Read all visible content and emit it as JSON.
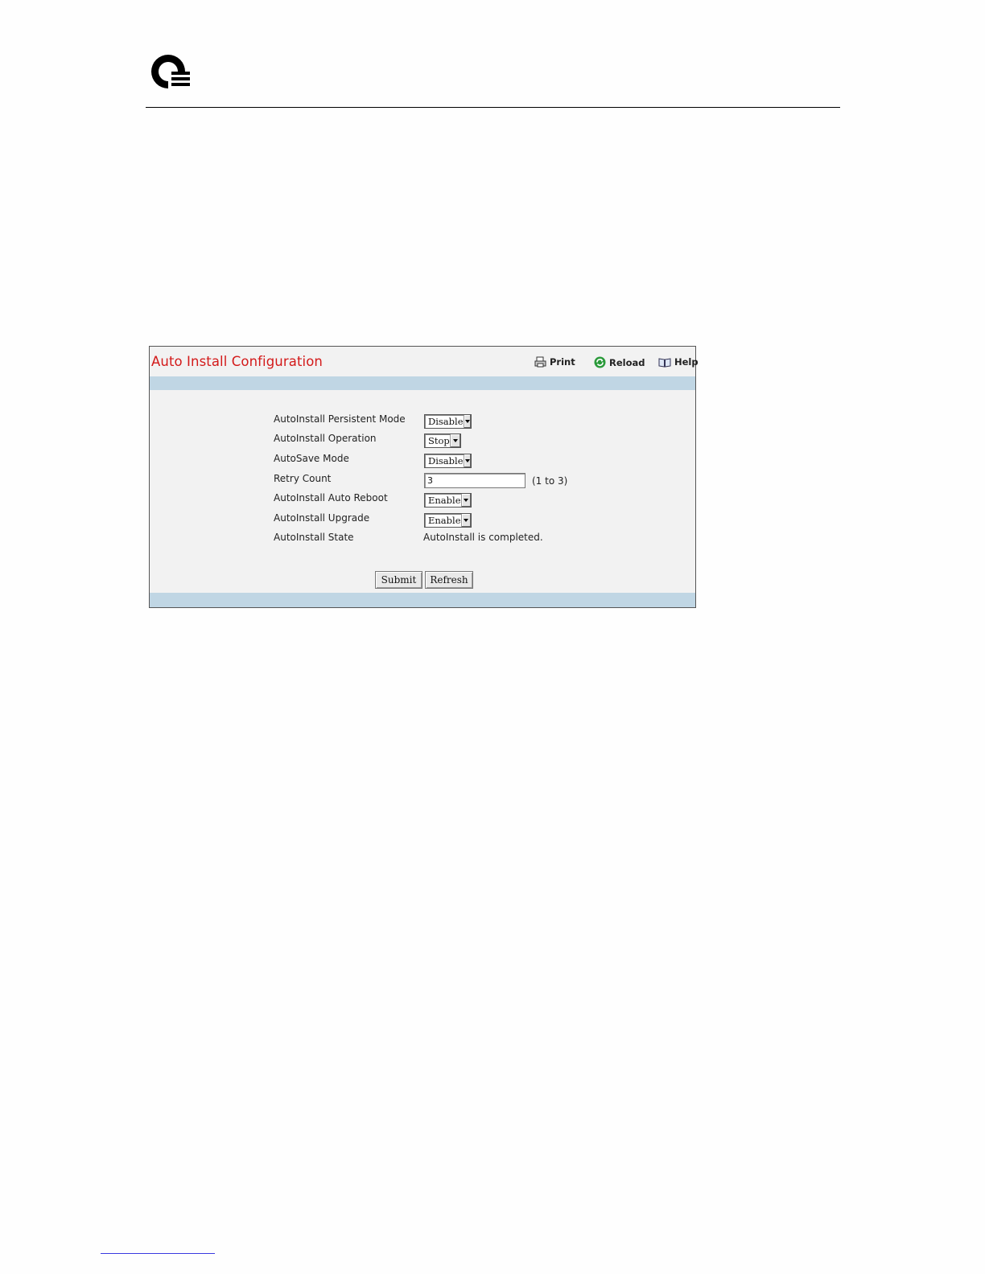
{
  "panel": {
    "title": "Auto Install Configuration",
    "toolbar": {
      "print_label": "Print",
      "reload_label": "Reload",
      "help_label": "Help"
    }
  },
  "form": {
    "persistent_mode": {
      "label": "AutoInstall Persistent Mode",
      "value": "Disable"
    },
    "operation": {
      "label": "AutoInstall Operation",
      "value": "Stop"
    },
    "autosave_mode": {
      "label": "AutoSave Mode",
      "value": "Disable"
    },
    "retry_count": {
      "label": "Retry Count",
      "value": "3",
      "hint": "(1 to 3)"
    },
    "auto_reboot": {
      "label": "AutoInstall Auto Reboot",
      "value": "Enable"
    },
    "upgrade": {
      "label": "AutoInstall Upgrade",
      "value": "Enable"
    },
    "state": {
      "label": "AutoInstall State",
      "value": "AutoInstall is completed."
    }
  },
  "buttons": {
    "submit_label": "Submit",
    "refresh_label": "Refresh"
  },
  "colors": {
    "title": "#d31a1a",
    "band": "#c0d6e4",
    "panel_bg": "#f2f2f2"
  }
}
